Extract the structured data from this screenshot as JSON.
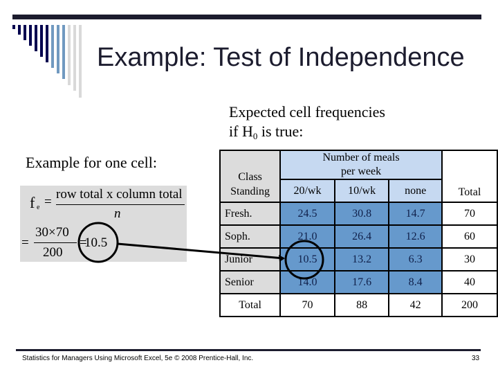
{
  "slide": {
    "title": "Example: Test of Independence",
    "expected_line1": "Expected cell frequencies",
    "expected_line2_pre": "if H",
    "expected_line2_sub": "0",
    "expected_line2_post": " is true:",
    "example_label": "Example for one cell:",
    "colors": {
      "dark_navy": "#00004f",
      "steel_blue": "#7099c0",
      "light_gray": "#d9d9d9",
      "cell_blue": "#6699cc",
      "header_blue": "#c6d9f1",
      "row_gray": "#dcdcdc"
    }
  },
  "formula": {
    "lhs_f": "f",
    "lhs_sub": "e",
    "eq": "=",
    "numerator": "row total x column total",
    "denominator": "n",
    "calc_eq": "=",
    "calc_numerator": "30×70",
    "calc_denominator": "200",
    "calc_eq2": "=",
    "result": "10.5"
  },
  "table": {
    "corner_line1": "Class",
    "corner_line2": "Standing",
    "group_header_line1": "Number of meals",
    "group_header_line2": "per week",
    "columns": [
      "20/wk",
      "10/wk",
      "none"
    ],
    "total_header": "Total",
    "rows": [
      {
        "label": "Fresh.",
        "values": [
          "24.5",
          "30.8",
          "14.7"
        ],
        "total": "70"
      },
      {
        "label": "Soph.",
        "values": [
          "21.0",
          "26.4",
          "12.6"
        ],
        "total": "60"
      },
      {
        "label": "Junior",
        "values": [
          "10.5",
          "13.2",
          "6.3"
        ],
        "total": "30"
      },
      {
        "label": "Senior",
        "values": [
          "14.0",
          "17.6",
          "8.4"
        ],
        "total": "40"
      }
    ],
    "totals_row": {
      "label": "Total",
      "values": [
        "70",
        "88",
        "42"
      ],
      "total": "200"
    }
  },
  "footer": {
    "text": "Statistics for Managers Using Microsoft Excel, 5e © 2008 Prentice-Hall, Inc.",
    "page_number": "33"
  }
}
